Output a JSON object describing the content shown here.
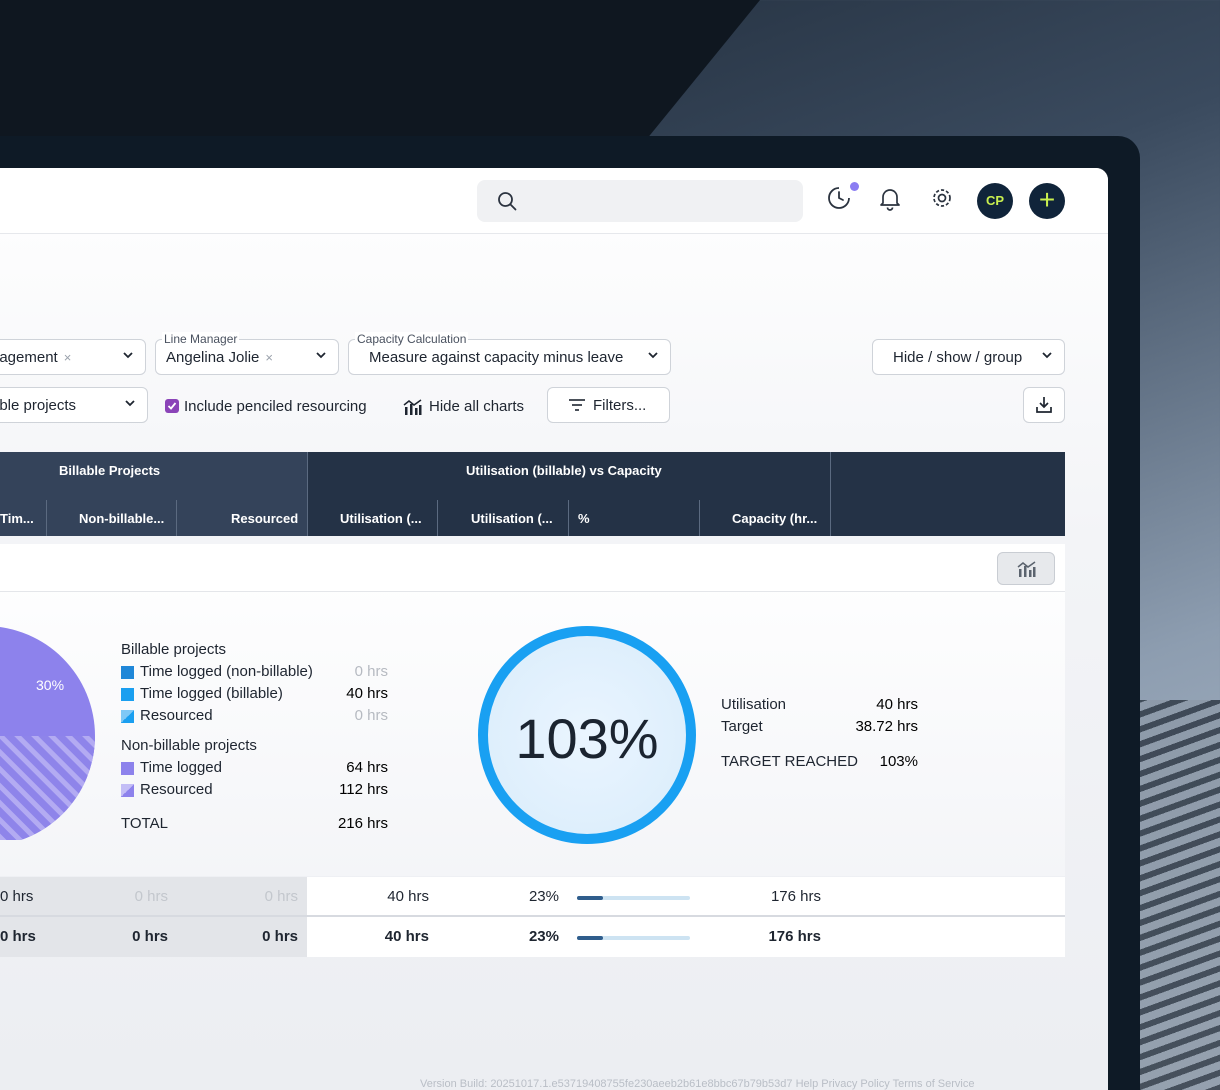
{
  "colors": {
    "header_bg": "#243246",
    "header_group_bg": "#34435a",
    "accent_blue": "#19a0f2",
    "purple": "#8b7df2",
    "avatar_bg": "#10243a",
    "avatar_fg": "#c9ef4f"
  },
  "topbar": {
    "avatar_initials": "CP",
    "icons": [
      "search-icon",
      "timer-icon",
      "bell-icon",
      "gear-icon",
      "plus-icon"
    ]
  },
  "filters": {
    "department_value": "nagement",
    "line_manager_legend": "Line Manager",
    "line_manager_value": "Angelina Jolie",
    "capacity_legend": "Capacity Calculation",
    "capacity_value": "Measure against capacity minus leave",
    "hide_show_label": "Hide / show / group",
    "projects_value": "able projects",
    "penciled_label": "Include penciled resourcing",
    "hide_charts_label": "Hide all charts",
    "filters_label": "Filters...",
    "remove_glyph": "×"
  },
  "table": {
    "group_headers": [
      "Billable Projects",
      "Utilisation (billable) vs Capacity"
    ],
    "columns": [
      "Tim...",
      "Non-billable...",
      "Resourced",
      "Utilisation (...",
      "Utilisation (...",
      "%",
      "Capacity (hr..."
    ]
  },
  "summary": {
    "pie_label": "30%",
    "billable_heading": "Billable projects",
    "billable_items": [
      {
        "label": "Time logged (non-billable)",
        "value": "0 hrs"
      },
      {
        "label": "Time logged (billable)",
        "value": "40 hrs"
      },
      {
        "label": "Resourced",
        "value": "0 hrs"
      }
    ],
    "nonbillable_heading": "Non-billable projects",
    "nonbillable_items": [
      {
        "label": "Time logged",
        "value": "64 hrs"
      },
      {
        "label": "Resourced",
        "value": "112 hrs"
      }
    ],
    "total_label": "TOTAL",
    "total_value": "216 hrs",
    "gauge_value": "103%",
    "stats": {
      "utilisation_label": "Utilisation",
      "utilisation_value": "40 hrs",
      "target_label": "Target",
      "target_value": "38.72 hrs",
      "reached_label": "TARGET REACHED",
      "reached_value": "103%"
    }
  },
  "rows": [
    {
      "c1": "0 hrs",
      "c2": "0 hrs",
      "c3": "0 hrs",
      "c4": "40 hrs",
      "c5": "23%",
      "progress": 0.23,
      "c6": "176 hrs"
    },
    {
      "c1": "0 hrs",
      "c2": "0 hrs",
      "c3": "0 hrs",
      "c4": "40 hrs",
      "c5": "23%",
      "progress": 0.23,
      "c6": "176 hrs"
    }
  ],
  "footer": "Version   Build: 20251017.1.e53719408755fe230aeeb2b61e8bbc67b79b53d7  Help   Privacy Policy   Terms of Service"
}
